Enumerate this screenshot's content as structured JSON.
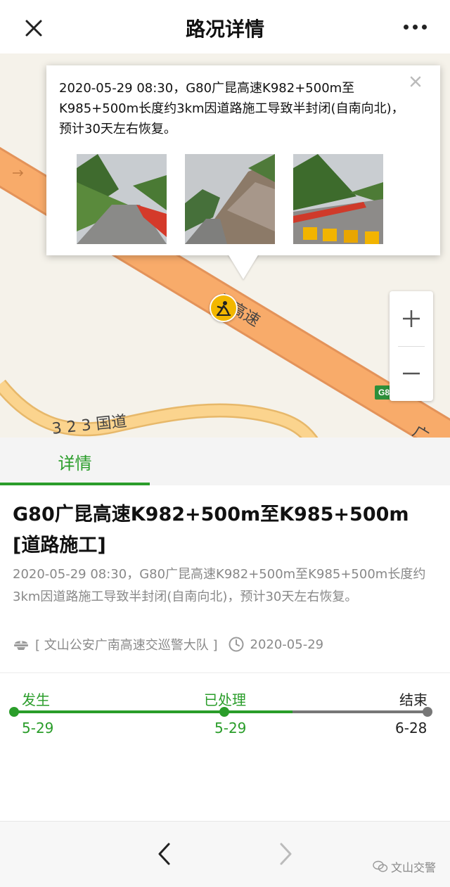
{
  "header": {
    "title": "路况详情"
  },
  "map": {
    "road_labels": {
      "expressway": "昆高速",
      "expressway_edge": "广",
      "national_road": "3 2 3 国道",
      "shield": "G8"
    },
    "zoom": {
      "in_symbol": "+",
      "out_symbol": "−"
    },
    "popup": {
      "text": "2020-05-29 08:30，G80广昆高速K982+500m至K985+500m长度约3km因道路施工导致半封闭(自南向北)，预计30天左右恢复。",
      "close_symbol": "×",
      "photo_count": 3
    },
    "marker_icon": "road-work-icon"
  },
  "tabs": [
    {
      "label": "详情",
      "active": true
    }
  ],
  "detail": {
    "title": "G80广昆高速K982+500m至K985+500m",
    "category": "[道路施工]",
    "description": "2020-05-29 08:30，G80广昆高速K982+500m至K985+500m长度约3km因道路施工导致半封闭(自南向北)，预计30天左右恢复。",
    "source": "[ 文山公安广南高速交巡警大队 ]",
    "date": "2020-05-29"
  },
  "timeline": {
    "stages": [
      {
        "label": "发生",
        "date": "5-29",
        "status": "done"
      },
      {
        "label": "已处理",
        "date": "5-29",
        "status": "done"
      },
      {
        "label": "结束",
        "date": "6-28",
        "status": "pending"
      }
    ],
    "colors": {
      "done": "#2a9d2a",
      "pending": "#777777"
    }
  },
  "footer": {
    "watermark": "文山交警"
  },
  "colors": {
    "accent": "#2a9d2a",
    "road": "#f7a65a",
    "marker": "#f2b700"
  }
}
